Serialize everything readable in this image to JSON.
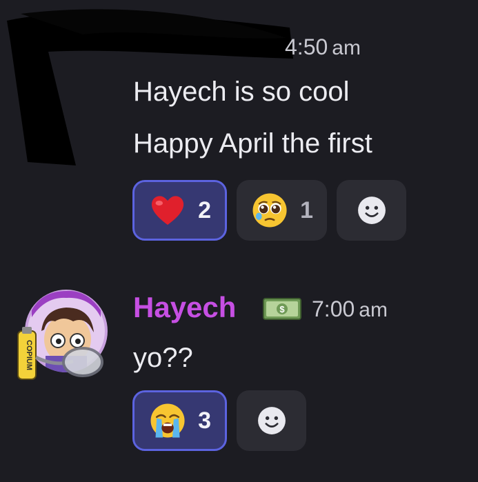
{
  "messages": [
    {
      "author": "",
      "timestamp": "4:50",
      "timestamp_ampm": "am",
      "lines": [
        "Hayech is so cool",
        "Happy April the first"
      ],
      "reactions": [
        {
          "emoji": "red-heart",
          "count": "2",
          "active": true
        },
        {
          "emoji": "pleading-face",
          "count": "1",
          "active": false
        }
      ]
    },
    {
      "author": "Hayech",
      "author_color": "#c64fe3",
      "badge": "dollar-banknote",
      "avatar_decoration_text": "COPIUM",
      "timestamp": "7:00",
      "timestamp_ampm": "am",
      "lines": [
        "yo??"
      ],
      "reactions": [
        {
          "emoji": "loudly-crying-face",
          "count": "3",
          "active": true
        }
      ]
    }
  ],
  "colors": {
    "background": "#1c1c22",
    "reaction_bg": "#2c2c33",
    "reaction_active_bg": "#363872",
    "reaction_active_border": "#5c63e0"
  }
}
